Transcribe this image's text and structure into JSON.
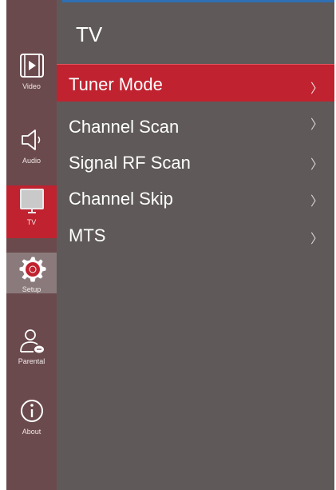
{
  "colors": {
    "panel": "#5f5a59",
    "sidebar": "#6b4a4d",
    "accent_red": "#c0222f",
    "text": "#ffffff"
  },
  "sidebar": {
    "items": [
      {
        "label": "Video",
        "icon": "film-icon"
      },
      {
        "label": "Audio",
        "icon": "speaker-icon"
      },
      {
        "label": "TV",
        "icon": "tv-icon",
        "active": true
      },
      {
        "label": "Setup",
        "icon": "gear-icon"
      },
      {
        "label": "Parental",
        "icon": "user-lock-icon"
      },
      {
        "label": "About",
        "icon": "info-icon"
      }
    ]
  },
  "main": {
    "title": "TV",
    "menu": [
      {
        "label": "Tuner Mode",
        "selected": true
      },
      {
        "label": "Channel Scan"
      },
      {
        "label": "Signal RF Scan"
      },
      {
        "label": "Channel Skip"
      },
      {
        "label": "MTS"
      }
    ],
    "chevron": "〉"
  }
}
